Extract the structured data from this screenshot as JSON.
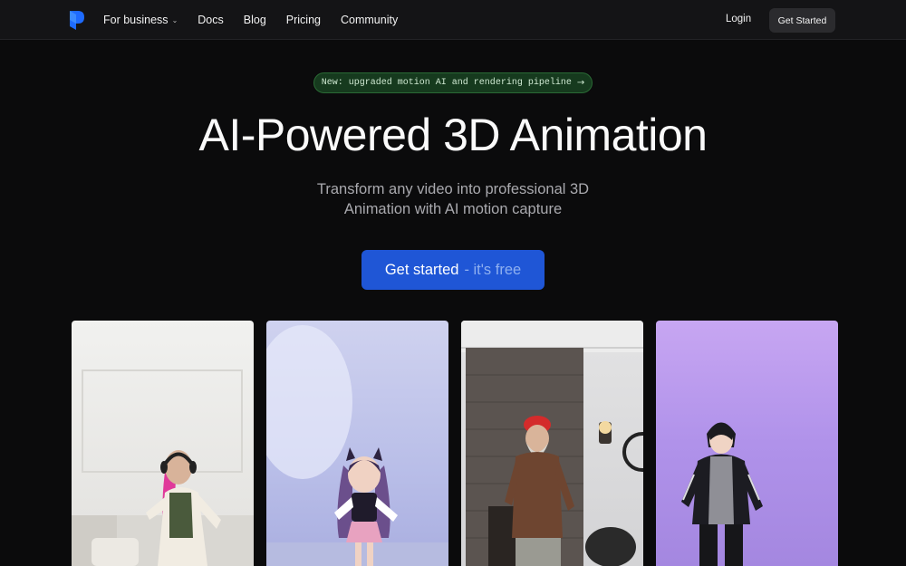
{
  "nav": {
    "items": [
      {
        "label": "For business",
        "has_dropdown": true
      },
      {
        "label": "Docs"
      },
      {
        "label": "Blog"
      },
      {
        "label": "Pricing"
      },
      {
        "label": "Community"
      }
    ],
    "login": "Login",
    "get_started": "Get Started"
  },
  "hero": {
    "badge": "New: upgraded motion AI and rendering pipeline",
    "title": "AI-Powered 3D Animation",
    "subtitle_line1": "Transform any video into professional 3D",
    "subtitle_line2": "Animation with AI motion capture",
    "cta_main": "Get started",
    "cta_sub": "- it's free"
  },
  "colors": {
    "background": "#0b0b0c",
    "accent": "#1f56d6",
    "badge_bg": "#163a1e"
  },
  "icons": {
    "logo": "brand-logo-icon",
    "caret": "chevron-down-icon",
    "badge_arrow": "arrow-right-icon"
  }
}
